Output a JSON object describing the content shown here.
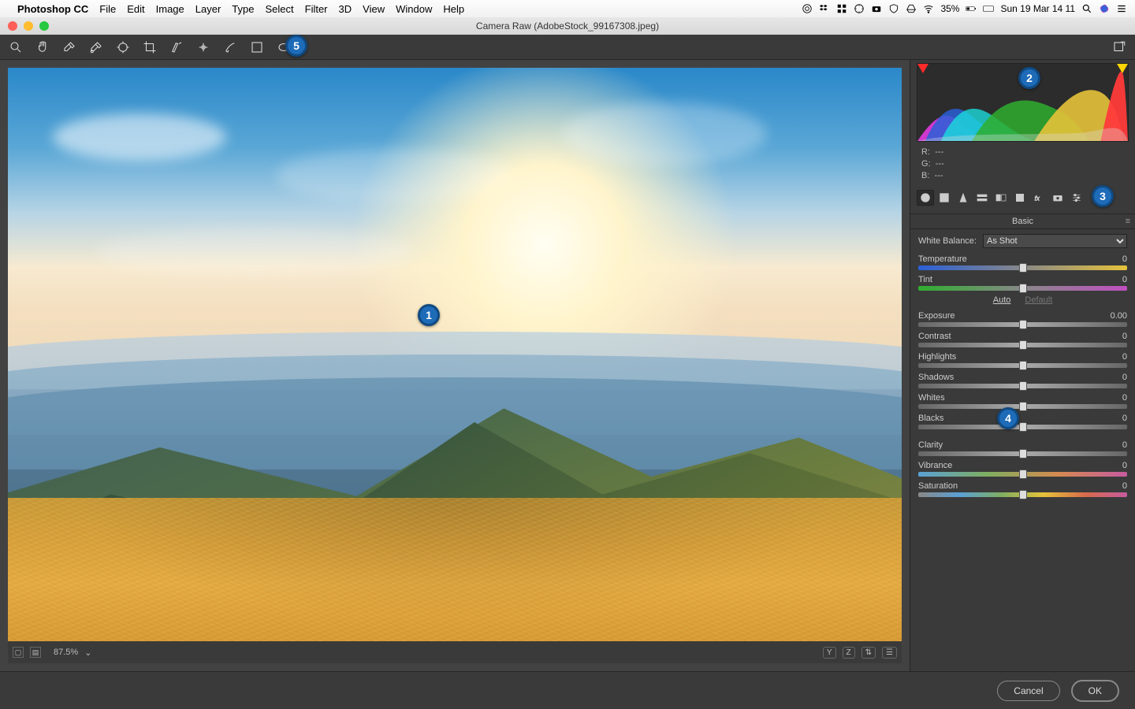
{
  "menubar": {
    "app": "Photoshop CC",
    "items": [
      "File",
      "Edit",
      "Image",
      "Layer",
      "Type",
      "Select",
      "Filter",
      "3D",
      "View",
      "Window",
      "Help"
    ],
    "battery": "35%",
    "clock": "Sun 19 Mar  14 11"
  },
  "window": {
    "title": "Camera Raw (AdobeStock_99167308.jpeg)"
  },
  "toolbar": {
    "tools": [
      "zoom",
      "hand",
      "eyedropper",
      "color-sampler",
      "target-adjust",
      "crop",
      "spot-removal",
      "redeye",
      "brush",
      "gradient",
      "radial"
    ],
    "toggle_right": "toggle-fullscreen"
  },
  "footer": {
    "zoom": "87.5%",
    "before_after": [
      "Y",
      "Z",
      "list"
    ]
  },
  "rgb": {
    "r_label": "R:",
    "g_label": "G:",
    "b_label": "B:",
    "dash": "---"
  },
  "tabs": {
    "title": "Basic"
  },
  "wb": {
    "label": "White Balance:",
    "value": "As Shot"
  },
  "sliders": [
    {
      "label": "Temperature",
      "value": "0",
      "grad": "grad-temp"
    },
    {
      "label": "Tint",
      "value": "0",
      "grad": "grad-tint"
    }
  ],
  "autodef": {
    "auto": "Auto",
    "default": "Default"
  },
  "sliders2": [
    {
      "label": "Exposure",
      "value": "0.00",
      "grad": "grad-gray"
    },
    {
      "label": "Contrast",
      "value": "0",
      "grad": "grad-gray"
    },
    {
      "label": "Highlights",
      "value": "0",
      "grad": "grad-gray"
    },
    {
      "label": "Shadows",
      "value": "0",
      "grad": "grad-gray"
    },
    {
      "label": "Whites",
      "value": "0",
      "grad": "grad-gray"
    },
    {
      "label": "Blacks",
      "value": "0",
      "grad": "grad-gray"
    }
  ],
  "sliders3": [
    {
      "label": "Clarity",
      "value": "0",
      "grad": "grad-gray"
    },
    {
      "label": "Vibrance",
      "value": "0",
      "grad": "grad-vib"
    },
    {
      "label": "Saturation",
      "value": "0",
      "grad": "grad-sat"
    }
  ],
  "buttons": {
    "cancel": "Cancel",
    "ok": "OK"
  },
  "callouts": {
    "1": "1",
    "2": "2",
    "3": "3",
    "4": "4",
    "5": "5"
  }
}
